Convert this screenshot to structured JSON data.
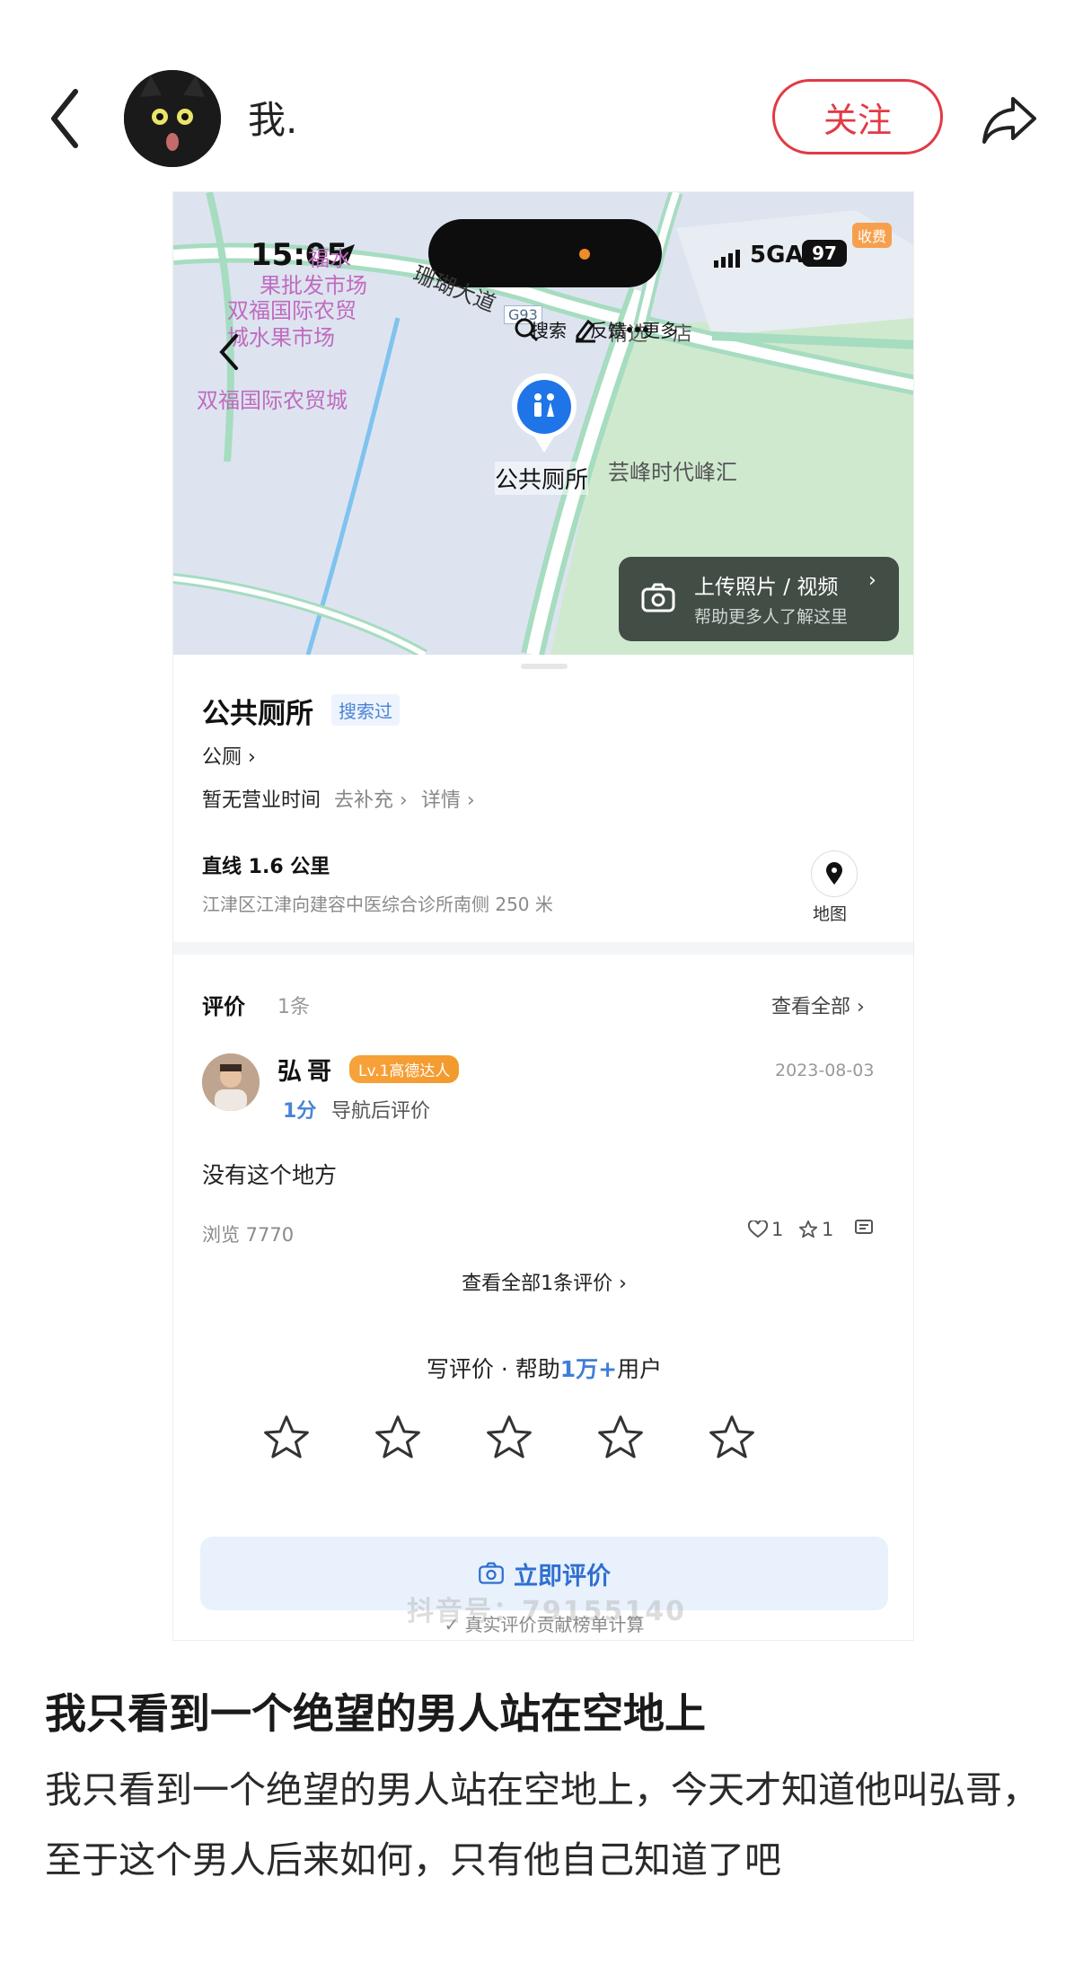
{
  "header": {
    "username": "我.",
    "follow_label": "关注"
  },
  "screenshot": {
    "status_bar": {
      "time": "15:05",
      "network": "5GA",
      "battery": "97",
      "charge_tag": "收费"
    },
    "map": {
      "labels": {
        "l1a": "福水",
        "l1b": "果批发市场",
        "l2a": "双福国际农贸",
        "l2b": "城水果市场",
        "l3": "双福国际农贸城",
        "road": "珊瑚大道",
        "road_tag": "G93",
        "l4": "芸峰时代峰汇",
        "l5": "精选",
        "l6": "店"
      },
      "tools": {
        "search": "搜索",
        "feedback": "反馈",
        "more": "更多"
      },
      "pin_label": "公共厕所",
      "upload": {
        "title": "上传照片 / 视频",
        "subtitle": "帮助更多人了解这里"
      }
    },
    "poi": {
      "name": "公共厕所",
      "searched_tag": "搜索过",
      "category": "公厕",
      "hours": "暂无营业时间",
      "add_info": "去补充",
      "details": "详情",
      "distance": "直线 1.6 公里",
      "address": "江津区江津向建容中医综合诊所南侧 250 米",
      "map_label": "地图"
    },
    "reviews": {
      "title": "评价",
      "count": "1条",
      "see_all": "查看全部",
      "items": [
        {
          "name": "弘哥",
          "badge": "Lv.1高德达人",
          "date": "2023-08-03",
          "score": "1分",
          "source": "导航后评价",
          "text": "没有这个地方",
          "views": "浏览 7770",
          "likes": "1",
          "stars": "1"
        }
      ],
      "see_all_reviews": "查看全部1条评价",
      "write_prefix": "写评价 · 帮助",
      "write_highlight": "1万+",
      "write_suffix": "用户",
      "cta_label": "立即评价",
      "footer_note": "真实评价贡献榜单计算",
      "watermark": "抖音号：79155140"
    }
  },
  "post": {
    "title": "我只看到一个绝望的男人站在空地上",
    "body": "我只看到一个绝望的男人站在空地上，今天才知道他叫弘哥，至于这个男人后来如何，只有他自己知道了吧"
  }
}
